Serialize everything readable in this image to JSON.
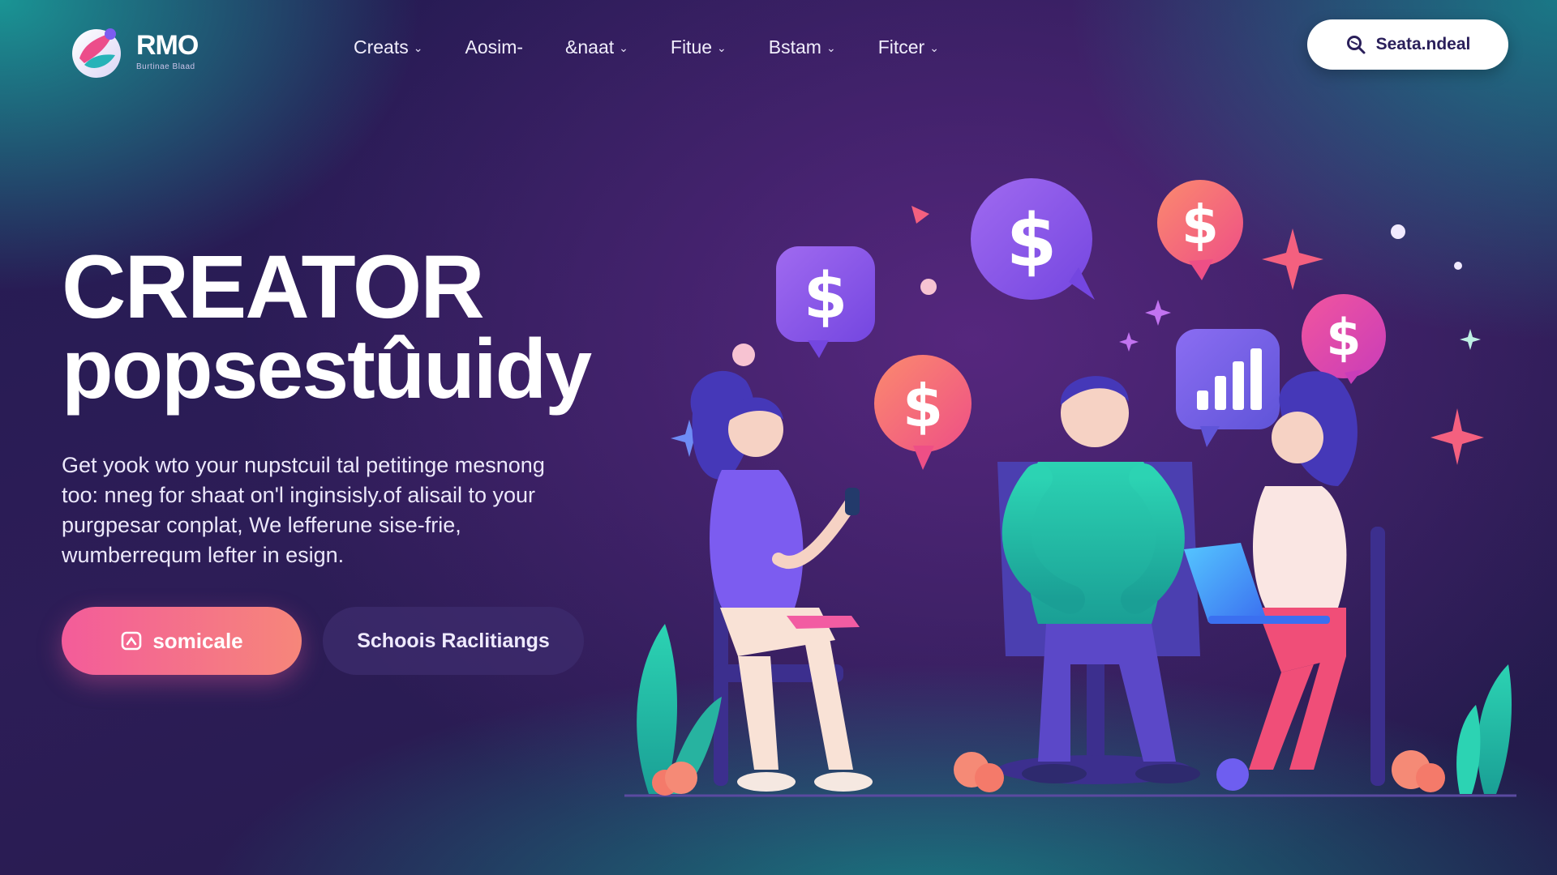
{
  "brand": {
    "name": "RMO",
    "tagline": "Burtinae Blaad"
  },
  "nav": {
    "items": [
      {
        "label": "Creats",
        "icon": "chevron-down-icon"
      },
      {
        "label": "Aosim-",
        "icon": ""
      },
      {
        "label": "&naat",
        "icon": "chevron-down-icon"
      },
      {
        "label": "Fitue",
        "icon": "chevron-down-icon"
      },
      {
        "label": "Bstam",
        "icon": "chevron-down-icon"
      },
      {
        "label": "Fitcer",
        "icon": "chevron-down-icon"
      }
    ]
  },
  "header_cta": {
    "label": "Seata.ndeal",
    "icon": "search-icon"
  },
  "hero": {
    "title_line1": "Creator",
    "title_line2": "popsestûuidy",
    "description": "Get yook wto your nupstcuil tal petitinge mesnong too: nneg for shaat on'l inginsisly.of alisail to your purgpesar conplat, We lefferune sise-frie, wumberrequm lefter in esign.",
    "primary_button": {
      "label": "somicale",
      "icon": "rocket-icon"
    },
    "secondary_button": {
      "label": "Schoois Raclitiangs"
    }
  },
  "colors": {
    "accent_pink": "#f35c9a",
    "accent_coral": "#f6867a",
    "accent_purple": "#8b5cf6",
    "accent_teal": "#14b8a6",
    "bg_dark": "#241a52"
  },
  "illustration": {
    "icons": [
      "dollar-bubble-icon",
      "dollar-bubble-icon",
      "dollar-bubble-icon",
      "dollar-bubble-icon",
      "dollar-bubble-icon",
      "bar-chart-bubble-icon",
      "sparkle-icon"
    ],
    "people": [
      "woman-with-tablet",
      "man-seated",
      "woman-with-laptop"
    ]
  }
}
